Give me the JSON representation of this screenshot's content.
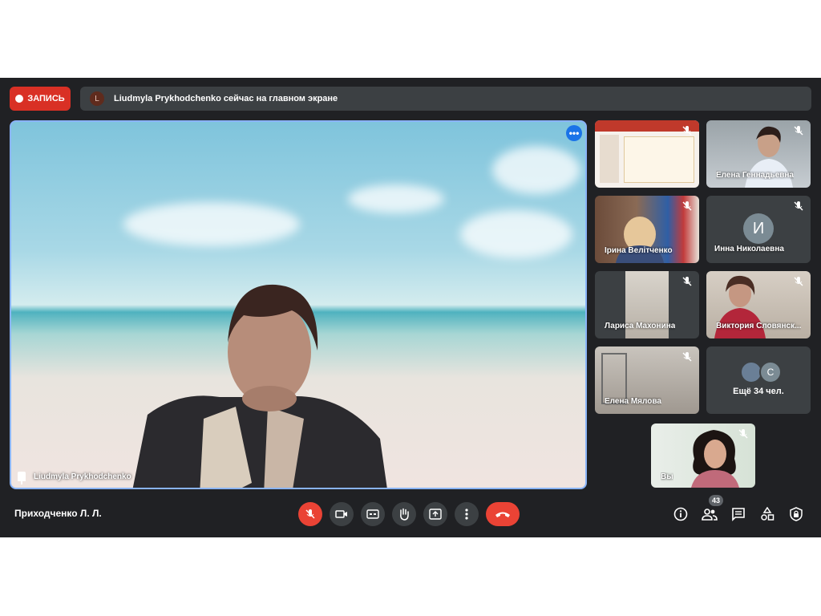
{
  "top_bar": {
    "record_label": "ЗАПИСЬ",
    "banner_avatar_letter": "L",
    "banner_text": "Liudmyla Prykhodchenko сейчас на главном экране"
  },
  "main_video": {
    "name": "Liudmyla Prykhodchenko",
    "more_label": "•••"
  },
  "tiles": [
    {
      "name": "",
      "kind": "presentation"
    },
    {
      "name": "Елена Геннадьевна",
      "kind": "video"
    },
    {
      "name": "Ірина Велітченко",
      "kind": "video"
    },
    {
      "name": "Инна Николаевна",
      "kind": "avatar",
      "letter": "И"
    },
    {
      "name": "Лариса Махонина",
      "kind": "video"
    },
    {
      "name": "Виктория Словянск...",
      "kind": "video"
    },
    {
      "name": "Елена Мялова",
      "kind": "video"
    },
    {
      "name": "Ещё 34 чел.",
      "kind": "more",
      "letter": "С"
    },
    {
      "name": "Вы",
      "kind": "video"
    }
  ],
  "bottom_bar": {
    "meeting_title": "Приходченко Л. Л.",
    "participants_count": "43"
  },
  "colors": {
    "background": "#202124",
    "record": "#d93025",
    "end_call": "#ea4335",
    "active_border": "#8ab4f8"
  }
}
